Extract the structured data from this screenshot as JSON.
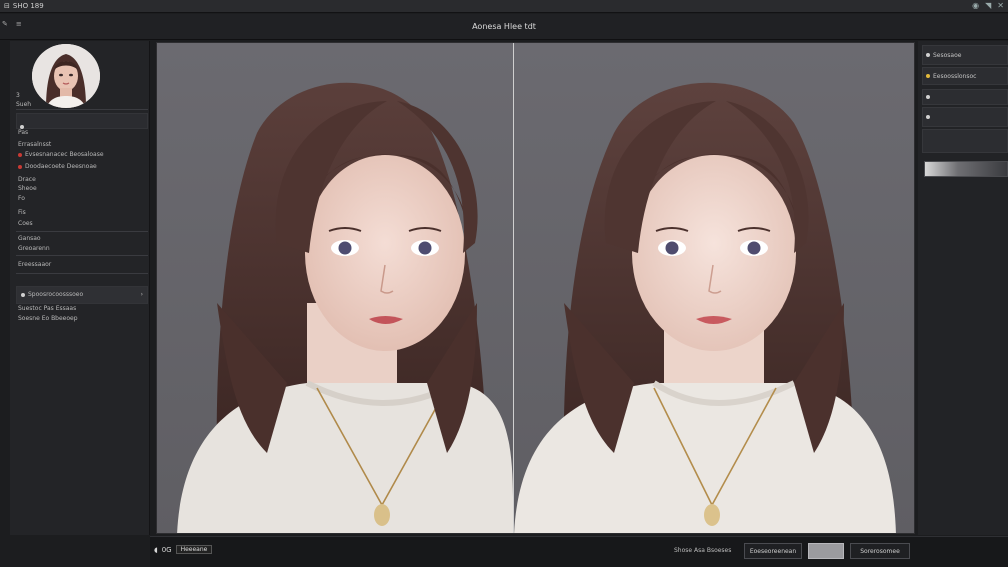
{
  "app": {
    "title": "SHO 189"
  },
  "toolbar": {
    "doc_title": "Aonesa Hlee tdt"
  },
  "left_panel": {
    "profile_label": "3",
    "profile_sublabel": "Sueh",
    "items": [
      {
        "label": "Pas"
      },
      {
        "label": "Errasalnsst"
      },
      {
        "label": "Evsesnanacec Beosaloase"
      },
      {
        "label": "Doodaecoete Deesnoae"
      },
      {
        "label": "Drace"
      },
      {
        "label": "Sheoe"
      },
      {
        "label": "Fo"
      },
      {
        "label": "Fis"
      },
      {
        "label": "Coes"
      },
      {
        "label": "Gansao"
      },
      {
        "label": "Greoarenn"
      },
      {
        "label": "Ereessaaor"
      }
    ],
    "selected_item": "Spoosrocoosssoeo",
    "sub_rows": [
      {
        "label": "Suestoc Pas Essaas"
      },
      {
        "label": "Soesne Eo Bbeeoep"
      }
    ]
  },
  "right_panel": {
    "rows": [
      {
        "label": "Sesosaoe"
      },
      {
        "label": "Eesoosslonsoc"
      },
      {
        "label": ""
      },
      {
        "label": ""
      },
      {
        "label": ""
      }
    ]
  },
  "bottom_bar": {
    "zoom_label": "0G",
    "zoom_value": "Heeeane",
    "status_text": "Shose Asa Bsoeses",
    "button_1": "Eoeseoreenean",
    "button_2": "",
    "button_3": "Sorerosomee"
  },
  "colors": {
    "background": "#1c1d1f",
    "panel": "#232427",
    "canvas": "#626166",
    "accent_red": "#c93a34",
    "accent_yellow": "#e2b93b"
  }
}
